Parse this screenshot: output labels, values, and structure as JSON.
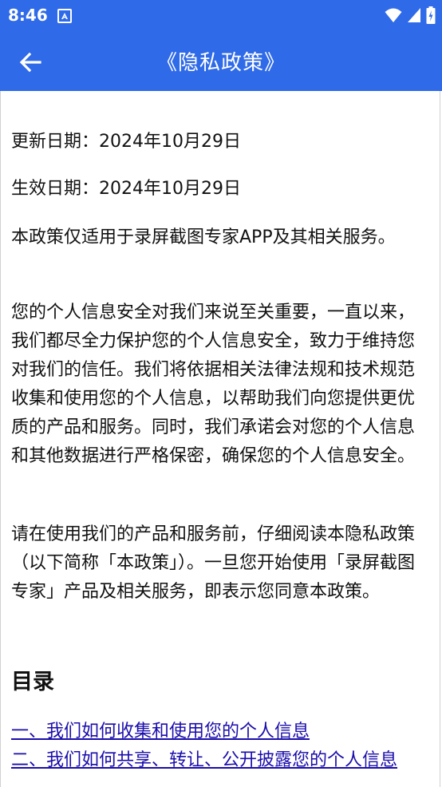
{
  "status_bar": {
    "time": "8:46",
    "icons": [
      "notification-icon",
      "wifi-icon",
      "signal-icon",
      "battery-icon"
    ]
  },
  "toolbar": {
    "title": "《隐私政策》",
    "back_icon": "arrow-left-icon",
    "color": "#2f6ae8"
  },
  "content": {
    "update_date": "更新日期：2024年10月29日",
    "effective_date": "生效日期：2024年10月29日",
    "paragraphs": [
      "本政策仅适用于录屏截图专家APP及其相关服务。",
      "您的个人信息安全对我们来说至关重要，一直以来，我们都尽全力保护您的个人信息安全，致力于维持您对我们的信任。我们将依据相关法律法规和技术规范收集和使用您的个人信息，以帮助我们向您提供更优质的产品和服务。同时，我们承诺会对您的个人信息和其他数据进行严格保密，确保您的个人信息安全。",
      "请在使用我们的产品和服务前，仔细阅读本隐私政策（以下简称「本政策」）。一旦您开始使用「录屏截图专家」产品及相关服务，即表示您同意本政策。"
    ],
    "toc_heading": "目录",
    "toc_links": [
      "一、我们如何收集和使用您的个人信息",
      "二、我们如何共享、转让、公开披露您的个人信息"
    ]
  }
}
